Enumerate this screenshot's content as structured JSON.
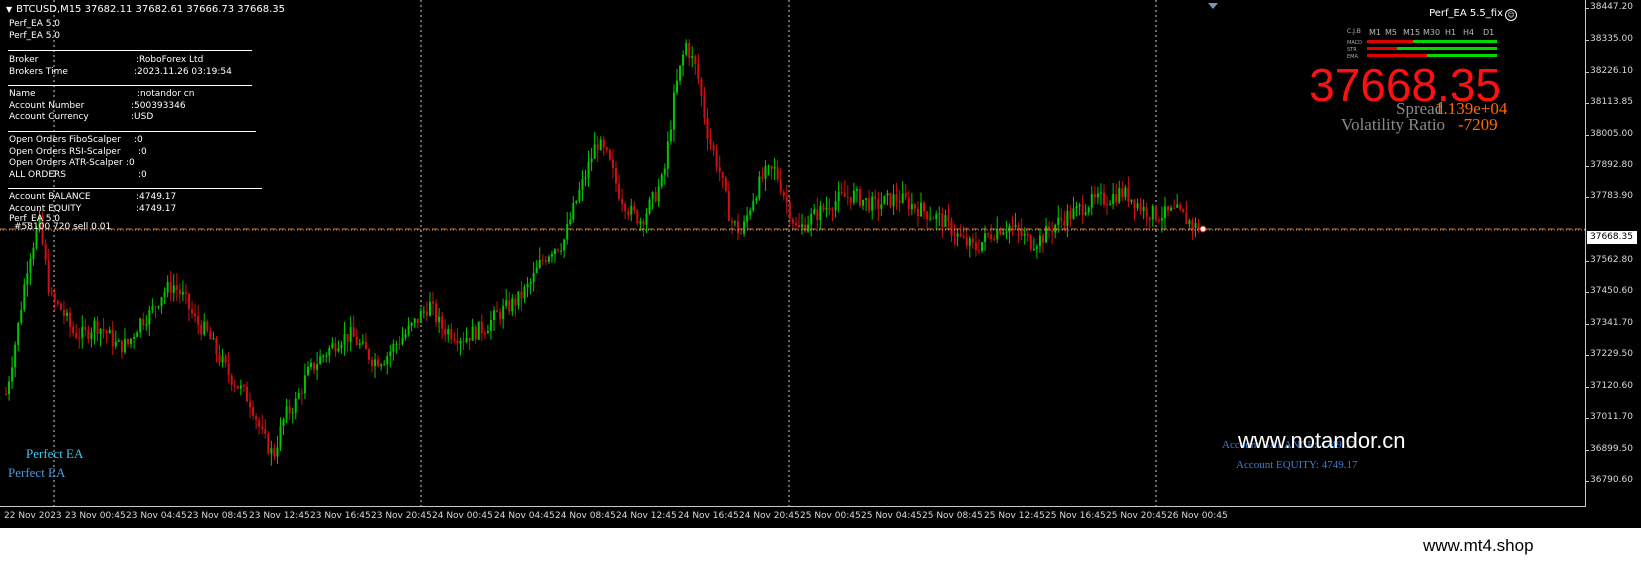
{
  "window": {
    "symbol_title": "BTCUSD,M15  37682.11 37682.61 37666.73 37668.35",
    "ea_name_top_right": "Perf_EA 5.5_fix",
    "current_price_label": "37668.35"
  },
  "info_panel": {
    "ea_lines": [
      "Perf_EA 5.0",
      "Perf_EA 5.0"
    ],
    "broker_label": "Broker",
    "broker_value": ":RoboForex Ltd",
    "broker_time_label": "Brokers Time",
    "broker_time_value": ":2023.11.26 03:19:54",
    "name_label": "Name",
    "name_value": ":notandor cn",
    "account_number_label": "Account Number",
    "account_number_value": ":500393346",
    "account_currency_label": "Account Currency",
    "account_currency_value": ":USD",
    "open_fibo_label": "Open Orders FiboScalper",
    "open_fibo_value": ":0",
    "open_rsi_label": "Open Orders RSI-Scalper",
    "open_rsi_value": ":0",
    "open_atr_label": "Open Orders ATR-Scalper",
    "open_atr_value": ":0",
    "all_orders_label": "ALL ORDERS",
    "all_orders_value": ":0",
    "balance_label": "Account BALANCE",
    "balance_value": ":4749.17",
    "equity_label": "Account EQUITY",
    "equity_value": ":4749.17",
    "ea_line_3": "Perf_EA 5.0",
    "order_line_label": "#58100 720 sell 0.01"
  },
  "timeframe_panel": {
    "headers": [
      "C.J.B",
      "M1",
      "M5",
      "M15",
      "M30",
      "H1",
      "H4",
      "D1"
    ],
    "rows": [
      "MACD",
      "STR",
      "EMA"
    ],
    "colors": {
      "up": "#00d800",
      "down": "#e00000"
    }
  },
  "big_display": {
    "price": "37668.35",
    "spread_label": "Spread",
    "spread_value": "1.139e+04",
    "volatility_label": "Volatility Ratio",
    "volatility_value": "-7209"
  },
  "overlays": {
    "perfect_ea_1": "Perfect EA",
    "perfect_ea_2": "Perfect EA",
    "account_balance_text": "Account BALANCE: 4749.17",
    "account_equity_text": "Account EQUITY:  4749.17",
    "watermark_site": "www.notandor.cn",
    "watermark_bottom": "www.mt4.shop"
  },
  "chart_data": {
    "type": "candlestick",
    "symbol": "BTCUSD",
    "timeframe": "M15",
    "last_price": 37668.35,
    "y_ticks": [
      "38447.20",
      "38335.00",
      "38226.10",
      "38113.85",
      "38005.00",
      "37892.80",
      "37783.90",
      "37668.35",
      "37562.80",
      "37450.60",
      "37341.70",
      "37229.50",
      "37120.60",
      "37011.70",
      "36899.50",
      "36790.60"
    ],
    "x_ticks": [
      "22 Nov 2023",
      "23 Nov 00:45",
      "23 Nov 04:45",
      "23 Nov 08:45",
      "23 Nov 12:45",
      "23 Nov 16:45",
      "23 Nov 20:45",
      "24 Nov 00:45",
      "24 Nov 04:45",
      "24 Nov 08:45",
      "24 Nov 12:45",
      "24 Nov 16:45",
      "24 Nov 20:45",
      "25 Nov 00:45",
      "25 Nov 04:45",
      "25 Nov 08:45",
      "25 Nov 12:45",
      "25 Nov 16:45",
      "25 Nov 20:45",
      "26 Nov 00:45"
    ],
    "ylim": [
      36770,
      38460
    ],
    "close_path": [
      37080,
      37300,
      37560,
      37690,
      37420,
      37380,
      37300,
      37290,
      37330,
      37300,
      37250,
      37260,
      37340,
      37370,
      37440,
      37470,
      37420,
      37340,
      37300,
      37220,
      37150,
      37100,
      37050,
      36930,
      36860,
      37000,
      37050,
      37150,
      37200,
      37240,
      37280,
      37290,
      37240,
      37200,
      37210,
      37260,
      37300,
      37350,
      37400,
      37320,
      37300,
      37280,
      37300,
      37320,
      37360,
      37390,
      37420,
      37470,
      37550,
      37600,
      37620,
      37750,
      37860,
      37980,
      37920,
      37800,
      37730,
      37700,
      37770,
      37850,
      38150,
      38330,
      38230,
      38000,
      37880,
      37700,
      37650,
      37780,
      37860,
      37880,
      37770,
      37660,
      37700,
      37730,
      37760,
      37780,
      37790,
      37770,
      37750,
      37770,
      37780,
      37760,
      37740,
      37720,
      37700,
      37660,
      37620,
      37600,
      37640,
      37670,
      37680,
      37650,
      37620,
      37640,
      37680,
      37710,
      37730,
      37760,
      37770,
      37780,
      37800,
      37780,
      37740,
      37720,
      37720,
      37730,
      37700,
      37668
    ],
    "order_line_price": 37668.35
  }
}
